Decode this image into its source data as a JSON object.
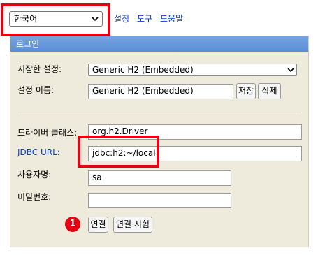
{
  "top": {
    "language_value": "한국어",
    "links": [
      "설정",
      "도구",
      "도움말"
    ]
  },
  "panel": {
    "title": "로그인",
    "saved_settings_label": "저장한 설정:",
    "saved_settings_value": "Generic H2 (Embedded)",
    "setting_name_label": "설정 이름:",
    "setting_name_value": "Generic H2 (Embedded)",
    "save_button": "저장",
    "delete_button": "삭제",
    "driver_class_label": "드라이버 클래스:",
    "driver_class_value": "org.h2.Driver",
    "jdbc_url_label": "JDBC URL:",
    "jdbc_url_value": "jdbc:h2:~/local",
    "username_label": "사용자명:",
    "username_value": "sa",
    "password_label": "비밀번호:",
    "password_value": "",
    "connect_button": "연결",
    "test_connection_button": "연결 시험"
  },
  "annotation": {
    "badge_number": "1"
  },
  "colors": {
    "highlight": "#e50012",
    "link": "#0a3ecd",
    "header": "#6a9ade",
    "panel_bg": "#eeeadc"
  }
}
